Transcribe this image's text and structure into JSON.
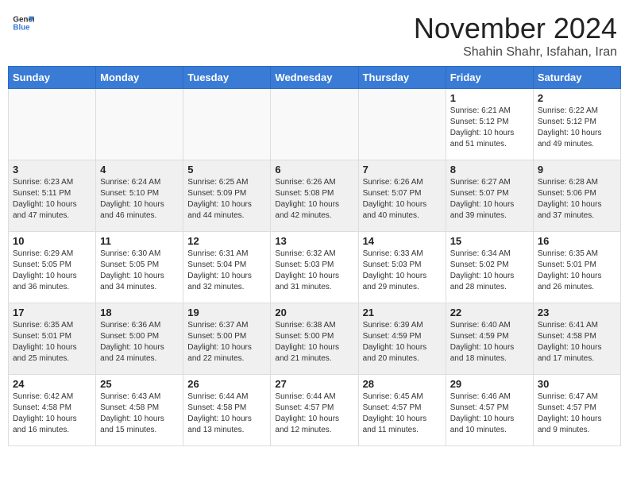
{
  "header": {
    "logo_general": "General",
    "logo_blue": "Blue",
    "month_title": "November 2024",
    "subtitle": "Shahin Shahr, Isfahan, Iran"
  },
  "days_of_week": [
    "Sunday",
    "Monday",
    "Tuesday",
    "Wednesday",
    "Thursday",
    "Friday",
    "Saturday"
  ],
  "weeks": [
    [
      {
        "day": "",
        "info": ""
      },
      {
        "day": "",
        "info": ""
      },
      {
        "day": "",
        "info": ""
      },
      {
        "day": "",
        "info": ""
      },
      {
        "day": "",
        "info": ""
      },
      {
        "day": "1",
        "info": "Sunrise: 6:21 AM\nSunset: 5:12 PM\nDaylight: 10 hours\nand 51 minutes."
      },
      {
        "day": "2",
        "info": "Sunrise: 6:22 AM\nSunset: 5:12 PM\nDaylight: 10 hours\nand 49 minutes."
      }
    ],
    [
      {
        "day": "3",
        "info": "Sunrise: 6:23 AM\nSunset: 5:11 PM\nDaylight: 10 hours\nand 47 minutes."
      },
      {
        "day": "4",
        "info": "Sunrise: 6:24 AM\nSunset: 5:10 PM\nDaylight: 10 hours\nand 46 minutes."
      },
      {
        "day": "5",
        "info": "Sunrise: 6:25 AM\nSunset: 5:09 PM\nDaylight: 10 hours\nand 44 minutes."
      },
      {
        "day": "6",
        "info": "Sunrise: 6:26 AM\nSunset: 5:08 PM\nDaylight: 10 hours\nand 42 minutes."
      },
      {
        "day": "7",
        "info": "Sunrise: 6:26 AM\nSunset: 5:07 PM\nDaylight: 10 hours\nand 40 minutes."
      },
      {
        "day": "8",
        "info": "Sunrise: 6:27 AM\nSunset: 5:07 PM\nDaylight: 10 hours\nand 39 minutes."
      },
      {
        "day": "9",
        "info": "Sunrise: 6:28 AM\nSunset: 5:06 PM\nDaylight: 10 hours\nand 37 minutes."
      }
    ],
    [
      {
        "day": "10",
        "info": "Sunrise: 6:29 AM\nSunset: 5:05 PM\nDaylight: 10 hours\nand 36 minutes."
      },
      {
        "day": "11",
        "info": "Sunrise: 6:30 AM\nSunset: 5:05 PM\nDaylight: 10 hours\nand 34 minutes."
      },
      {
        "day": "12",
        "info": "Sunrise: 6:31 AM\nSunset: 5:04 PM\nDaylight: 10 hours\nand 32 minutes."
      },
      {
        "day": "13",
        "info": "Sunrise: 6:32 AM\nSunset: 5:03 PM\nDaylight: 10 hours\nand 31 minutes."
      },
      {
        "day": "14",
        "info": "Sunrise: 6:33 AM\nSunset: 5:03 PM\nDaylight: 10 hours\nand 29 minutes."
      },
      {
        "day": "15",
        "info": "Sunrise: 6:34 AM\nSunset: 5:02 PM\nDaylight: 10 hours\nand 28 minutes."
      },
      {
        "day": "16",
        "info": "Sunrise: 6:35 AM\nSunset: 5:01 PM\nDaylight: 10 hours\nand 26 minutes."
      }
    ],
    [
      {
        "day": "17",
        "info": "Sunrise: 6:35 AM\nSunset: 5:01 PM\nDaylight: 10 hours\nand 25 minutes."
      },
      {
        "day": "18",
        "info": "Sunrise: 6:36 AM\nSunset: 5:00 PM\nDaylight: 10 hours\nand 24 minutes."
      },
      {
        "day": "19",
        "info": "Sunrise: 6:37 AM\nSunset: 5:00 PM\nDaylight: 10 hours\nand 22 minutes."
      },
      {
        "day": "20",
        "info": "Sunrise: 6:38 AM\nSunset: 5:00 PM\nDaylight: 10 hours\nand 21 minutes."
      },
      {
        "day": "21",
        "info": "Sunrise: 6:39 AM\nSunset: 4:59 PM\nDaylight: 10 hours\nand 20 minutes."
      },
      {
        "day": "22",
        "info": "Sunrise: 6:40 AM\nSunset: 4:59 PM\nDaylight: 10 hours\nand 18 minutes."
      },
      {
        "day": "23",
        "info": "Sunrise: 6:41 AM\nSunset: 4:58 PM\nDaylight: 10 hours\nand 17 minutes."
      }
    ],
    [
      {
        "day": "24",
        "info": "Sunrise: 6:42 AM\nSunset: 4:58 PM\nDaylight: 10 hours\nand 16 minutes."
      },
      {
        "day": "25",
        "info": "Sunrise: 6:43 AM\nSunset: 4:58 PM\nDaylight: 10 hours\nand 15 minutes."
      },
      {
        "day": "26",
        "info": "Sunrise: 6:44 AM\nSunset: 4:58 PM\nDaylight: 10 hours\nand 13 minutes."
      },
      {
        "day": "27",
        "info": "Sunrise: 6:44 AM\nSunset: 4:57 PM\nDaylight: 10 hours\nand 12 minutes."
      },
      {
        "day": "28",
        "info": "Sunrise: 6:45 AM\nSunset: 4:57 PM\nDaylight: 10 hours\nand 11 minutes."
      },
      {
        "day": "29",
        "info": "Sunrise: 6:46 AM\nSunset: 4:57 PM\nDaylight: 10 hours\nand 10 minutes."
      },
      {
        "day": "30",
        "info": "Sunrise: 6:47 AM\nSunset: 4:57 PM\nDaylight: 10 hours\nand 9 minutes."
      }
    ]
  ]
}
